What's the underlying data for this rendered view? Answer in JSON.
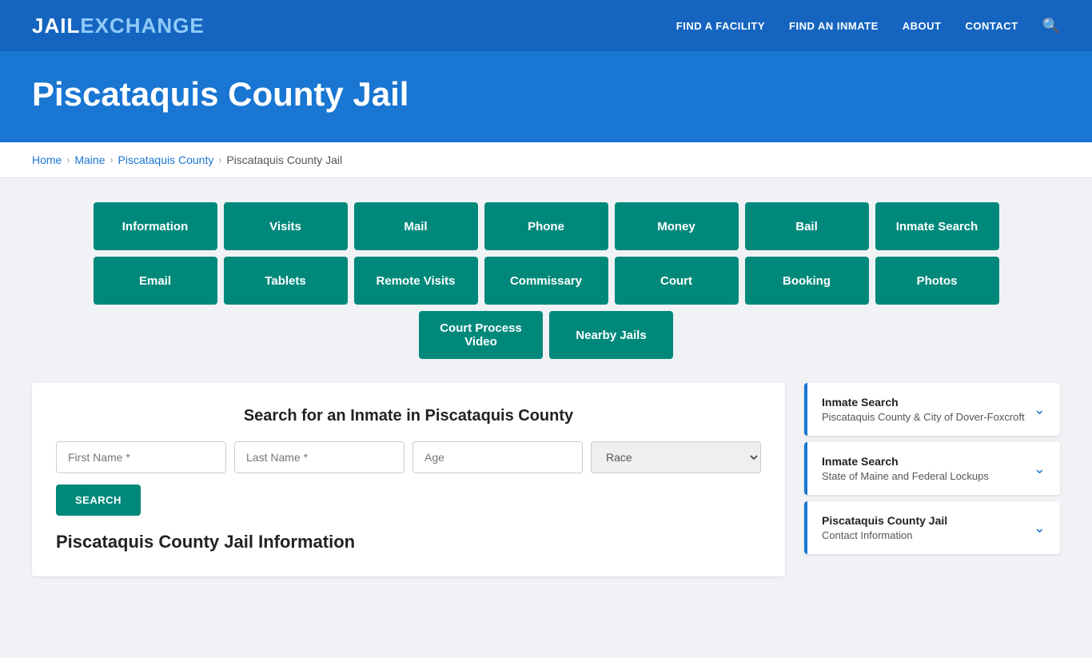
{
  "header": {
    "logo_jail": "JAIL",
    "logo_exchange": "EXCHANGE",
    "nav": [
      {
        "label": "FIND A FACILITY",
        "id": "find-facility"
      },
      {
        "label": "FIND AN INMATE",
        "id": "find-inmate"
      },
      {
        "label": "ABOUT",
        "id": "about"
      },
      {
        "label": "CONTACT",
        "id": "contact"
      }
    ]
  },
  "hero": {
    "title": "Piscataquis County Jail"
  },
  "breadcrumb": {
    "items": [
      {
        "label": "Home",
        "id": "home"
      },
      {
        "label": "Maine",
        "id": "maine"
      },
      {
        "label": "Piscataquis County",
        "id": "piscataquis-county"
      },
      {
        "label": "Piscataquis County Jail",
        "id": "piscataquis-county-jail"
      }
    ]
  },
  "buttons_row1": [
    {
      "label": "Information"
    },
    {
      "label": "Visits"
    },
    {
      "label": "Mail"
    },
    {
      "label": "Phone"
    },
    {
      "label": "Money"
    },
    {
      "label": "Bail"
    },
    {
      "label": "Inmate Search"
    }
  ],
  "buttons_row2": [
    {
      "label": "Email"
    },
    {
      "label": "Tablets"
    },
    {
      "label": "Remote Visits"
    },
    {
      "label": "Commissary"
    },
    {
      "label": "Court"
    },
    {
      "label": "Booking"
    },
    {
      "label": "Photos"
    }
  ],
  "buttons_row3": [
    {
      "label": "Court Process Video"
    },
    {
      "label": "Nearby Jails"
    }
  ],
  "search_form": {
    "title": "Search for an Inmate in Piscataquis County",
    "first_name_placeholder": "First Name *",
    "last_name_placeholder": "Last Name *",
    "age_placeholder": "Age",
    "race_placeholder": "Race",
    "search_button": "SEARCH"
  },
  "sidebar": {
    "cards": [
      {
        "main_title": "Inmate Search",
        "sub_title": "Piscataquis County & City of Dover-Foxcroft"
      },
      {
        "main_title": "Inmate Search",
        "sub_title": "State of Maine and Federal Lockups"
      },
      {
        "main_title": "Piscataquis County Jail",
        "sub_title": "Contact Information"
      }
    ]
  },
  "page_section_title": "Piscataquis County Jail Information"
}
